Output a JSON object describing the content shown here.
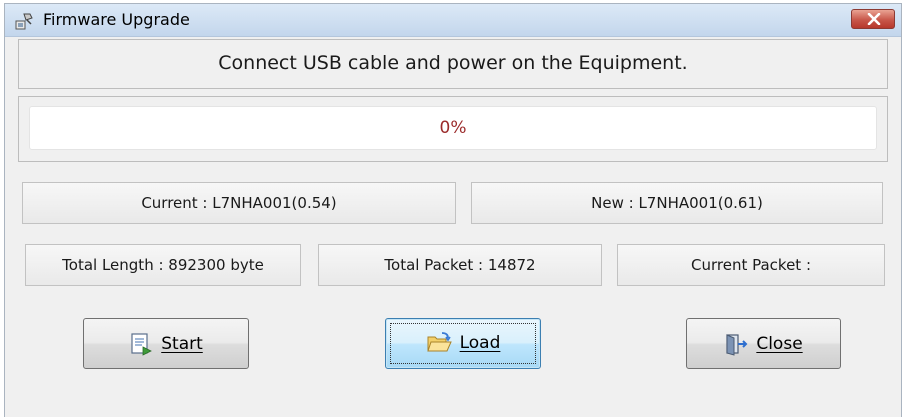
{
  "window": {
    "title": "Firmware Upgrade",
    "icons": {
      "app": "firmware-upgrade-icon",
      "close": "close-icon"
    },
    "colors": {
      "titlebar": "#c3d6ec",
      "close_button": "#c8574a"
    }
  },
  "message": {
    "text": "Connect USB cable and power on the Equipment."
  },
  "progress": {
    "label": "0%",
    "value_fraction": 0,
    "label_color": "#9b2b2b"
  },
  "versions": {
    "current": "Current : L7NHA001(0.54)",
    "new": "New : L7NHA001(0.61)"
  },
  "stats": {
    "total_length": "Total Length : 892300 byte",
    "total_packet": "Total Packet : 14872",
    "current_packet": "Current Packet :"
  },
  "buttons": {
    "start": {
      "label": "Start",
      "icon": "start-document-icon"
    },
    "load": {
      "label": "Load",
      "icon": "open-folder-icon"
    },
    "close": {
      "label": "Close",
      "icon": "exit-door-icon"
    }
  }
}
